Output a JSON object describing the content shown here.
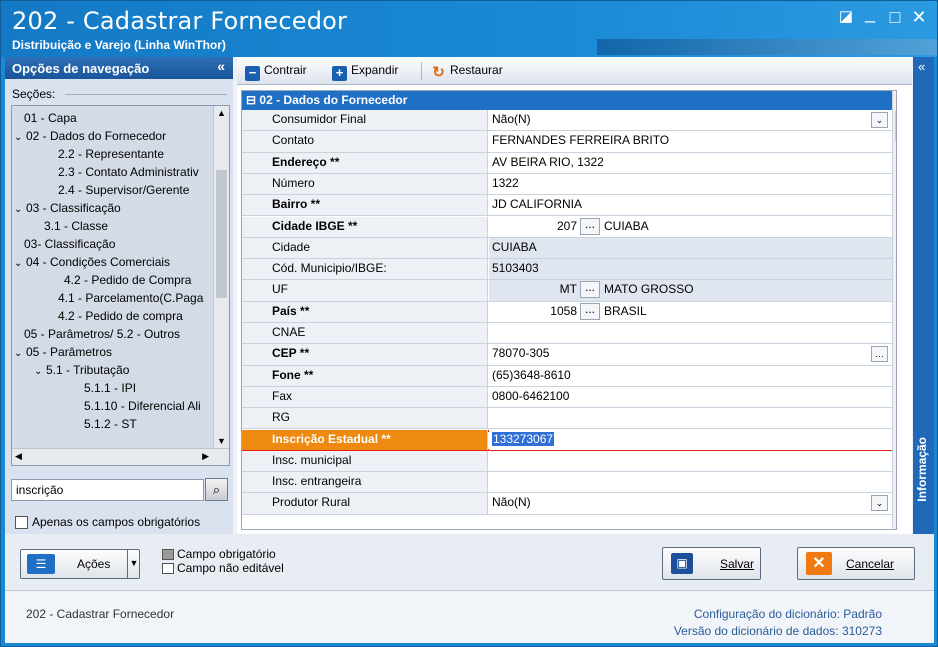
{
  "window": {
    "title": "202 - Cadastrar  Fornecedor",
    "subtitle": "Distribuição e Varejo (Linha WinThor)",
    "minimize": "_",
    "restore": "□",
    "close": "✕",
    "pin": "◪"
  },
  "nav": {
    "header": "Opções de navegação",
    "collapse": "«",
    "sections_label": "Seções:",
    "items": [
      "01 - Capa",
      "02 - Dados do Fornecedor",
      "2.2 - Representante",
      "2.3 - Contato Administrativ",
      "2.4 - Supervisor/Gerente",
      "03 - Classificação",
      "3.1 - Classe",
      "03- Classificação",
      "04 - Condições Comerciais",
      "4.2 - Pedido de Compra",
      "4.1 - Parcelamento(C.Paga",
      "4.2 - Pedido de compra",
      "05 - Parâmetros/ 5.2 - Outros",
      "05 - Parâmetros",
      "5.1 - Tributação",
      "5.1.1 - IPI",
      "5.1.10 - Diferencial Ali",
      "5.1.2 - ST"
    ],
    "search_value": "inscrição",
    "only_required": "Apenas os campos obrigatórios"
  },
  "toolbar": {
    "collapse": "Contrair",
    "expand": "Expandir",
    "restore": "Restaurar",
    "collapse_panel": "«"
  },
  "grid": {
    "group": "02 - Dados do Fornecedor",
    "rows": [
      {
        "label": "Consumidor Final",
        "value": "Não(N)"
      },
      {
        "label": "Contato",
        "value": "FERNANDES FERREIRA BRITO"
      },
      {
        "label": "Endereço **",
        "value": "AV BEIRA RIO, 1322"
      },
      {
        "label": "Número",
        "value": "1322"
      },
      {
        "label": "Bairro **",
        "value": "JD CALIFORNIA"
      },
      {
        "label": "Cidade IBGE **",
        "code": "207",
        "value": "CUIABA"
      },
      {
        "label": "Cidade",
        "value": "CUIABA"
      },
      {
        "label": "Cód. Municipio/IBGE:",
        "value": "5103403"
      },
      {
        "label": "UF",
        "code": "MT",
        "value": "MATO GROSSO"
      },
      {
        "label": "País **",
        "code": "1058",
        "value": "BRASIL"
      },
      {
        "label": "CNAE",
        "value": ""
      },
      {
        "label": "CEP **",
        "value": "78070-305"
      },
      {
        "label": "Fone **",
        "value": "(65)3648-8610"
      },
      {
        "label": "Fax",
        "value": "0800-6462100"
      },
      {
        "label": "RG",
        "value": ""
      },
      {
        "label": "Inscrição Estadual **",
        "value": "133273067"
      },
      {
        "label": "Insc. municipal",
        "value": ""
      },
      {
        "label": "Insc. entrangeira",
        "value": ""
      },
      {
        "label": "Produtor Rural",
        "value": "Não(N)"
      }
    ],
    "ellipsis": "...",
    "info_tab": "Informação"
  },
  "bottom": {
    "actions": "Ações",
    "legend_required": "Campo obrigatório",
    "legend_readonly": "Campo não editável",
    "save": "Salvar",
    "cancel": "Cancelar"
  },
  "status": {
    "app": "202 - Cadastrar  Fornecedor",
    "dict_config_label": "Configuração do dicionário:",
    "dict_config_value": "Padrão",
    "dict_version_label": "Versão do dicionário de dados:",
    "dict_version_value": "310273"
  },
  "colors": {
    "title_blue": "#1b88d4",
    "highlight_orange": "#ee8a10",
    "highlight_border": "#e02020",
    "selection_blue": "#2f6fd6"
  }
}
